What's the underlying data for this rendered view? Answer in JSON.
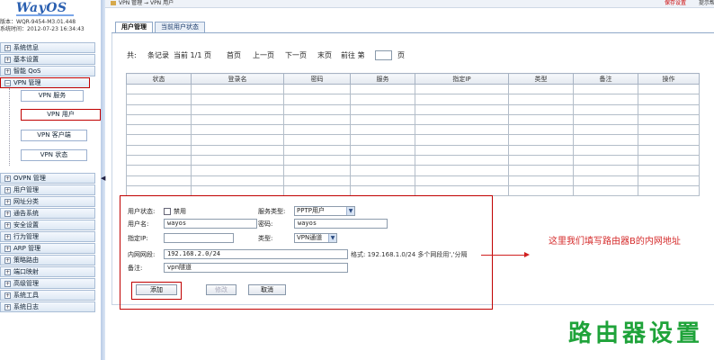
{
  "sidebar": {
    "logo": "WayOS",
    "version_label": "版本：",
    "version_value": "WQR-9454-M3.01.448",
    "time_label": "系统时间：",
    "time_value": "2012-07-23 16:34:43",
    "menu_top": [
      {
        "label": "系统信息"
      },
      {
        "label": "基本设置"
      },
      {
        "label": "智能 QoS"
      },
      {
        "label": "VPN 管理"
      }
    ],
    "vpn_sub": [
      {
        "label": "VPN 服务"
      },
      {
        "label": "VPN 用户"
      },
      {
        "label": "VPN 客户端"
      },
      {
        "label": "VPN 状态"
      }
    ],
    "menu_bottom": [
      {
        "label": "OVPN 管理"
      },
      {
        "label": "用户管理"
      },
      {
        "label": "网址分类"
      },
      {
        "label": "通告系统"
      },
      {
        "label": "安全设置"
      },
      {
        "label": "行为管理"
      },
      {
        "label": "ARP 管理"
      },
      {
        "label": "策略路由"
      },
      {
        "label": "端口映射"
      },
      {
        "label": "高级管理"
      },
      {
        "label": "系统工具"
      },
      {
        "label": "系统日志"
      }
    ]
  },
  "topbar": {
    "breadcrumb": "VPN 管理 → VPN 用户",
    "save_settings": "保存设置",
    "tips": "提示帮"
  },
  "tabs": [
    {
      "label": "用户管理",
      "active": true
    },
    {
      "label": "当前用户状态",
      "active": false
    }
  ],
  "pager": {
    "total_prefix": "共:",
    "records": "条记录",
    "current": "当前 1/1 页",
    "first": "首页",
    "prev": "上一页",
    "next": "下一页",
    "last": "末页",
    "goto": "前往 第",
    "page_suffix": "页"
  },
  "table": {
    "columns": [
      "状态",
      "登录名",
      "密码",
      "服务",
      "指定IP",
      "类型",
      "备注",
      "操作"
    ],
    "empty_rows": 11
  },
  "form": {
    "status_label": "用户状态:",
    "disable_label": "禁用",
    "service_type_label": "服务类型:",
    "service_type_value": "PPTP用户",
    "username_label": "用户名:",
    "username_value": "wayos",
    "password_label": "密码:",
    "password_value": "wayos",
    "ip_label": "指定IP:",
    "ip_value": "",
    "type_label": "类型:",
    "type_value": "VPN通道",
    "subnet_label": "内网网段:",
    "subnet_value": "192.168.2.0/24",
    "subnet_hint": "格式: 192.168.1.0/24 多个网段用','分隔",
    "remark_label": "备注:",
    "remark_value": "vpn隧道",
    "add_button": "添加",
    "modify_button": "修改",
    "cancel_button": "取消"
  },
  "annotation": "这里我们填写路由器B的内网地址",
  "watermark": "路由器设置",
  "colors": {
    "highlight_red": "#c00000",
    "annotation_red": "#d52b2b",
    "watermark_green": "#1fa33a",
    "logo_blue": "#2a5fb0"
  }
}
